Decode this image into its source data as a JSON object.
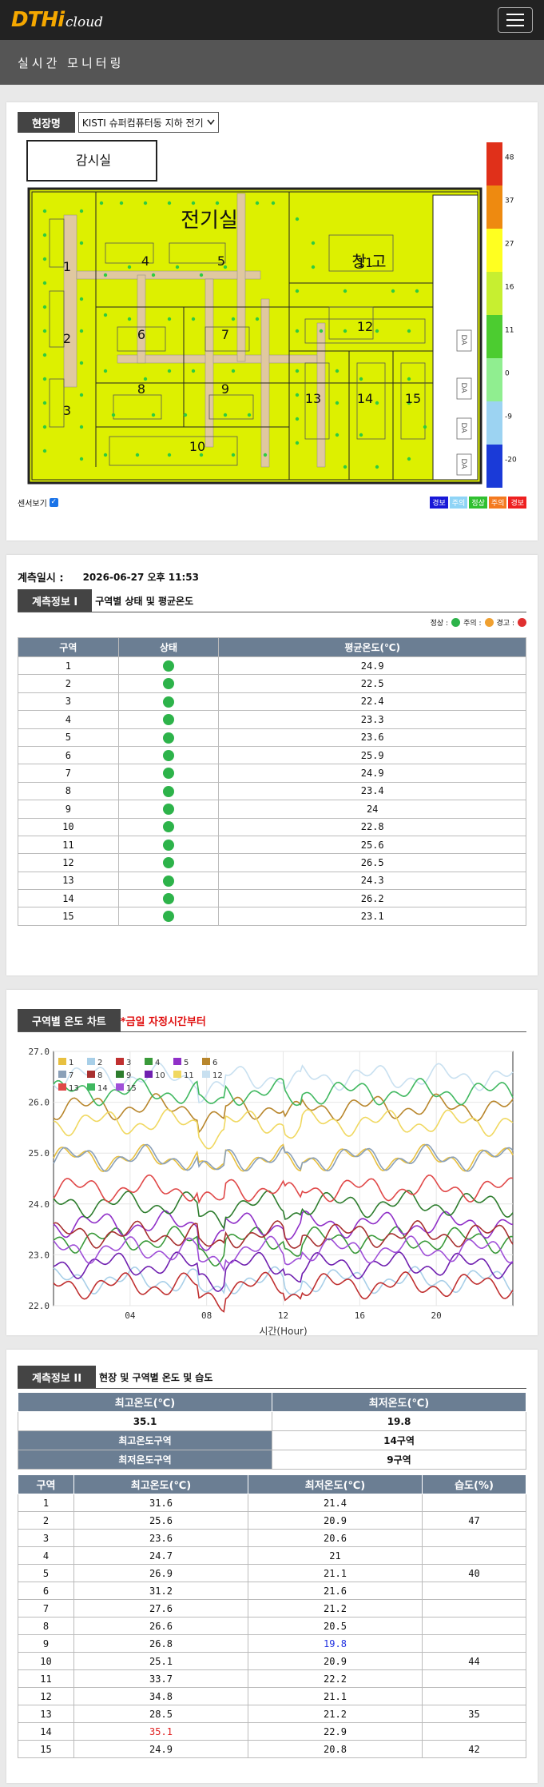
{
  "header": {
    "logo_main": "DTHi",
    "logo_sub": "cloud"
  },
  "subbar": {
    "title": "실시간 모니터링"
  },
  "site": {
    "label": "현장명",
    "selected": "KISTI 슈퍼컴퓨터동 지하 전기",
    "room_labels": {
      "control": "감시실",
      "electric": "전기실",
      "storage": "창 고"
    },
    "zones": [
      "1",
      "2",
      "3",
      "4",
      "5",
      "6",
      "7",
      "8",
      "9",
      "10",
      "11",
      "12",
      "13",
      "14",
      "15"
    ],
    "scale_labels": [
      "48",
      "37",
      "27",
      "16",
      "11",
      "0",
      "-9",
      "-20"
    ],
    "scale_colors": [
      "#e0301a",
      "#ee8a10",
      "#ffff20",
      "#c7ef30",
      "#4ccc30",
      "#90ee90",
      "#9cd3f2",
      "#1a3ad8"
    ],
    "sensor_label": "센서보기",
    "status_buttons": [
      {
        "label": "경보",
        "color": "#1818d8"
      },
      {
        "label": "주의",
        "color": "#8fd4f6"
      },
      {
        "label": "정상",
        "color": "#30c030"
      },
      {
        "label": "주의",
        "color": "#f47a20"
      },
      {
        "label": "경보",
        "color": "#ee2020"
      }
    ],
    "door_label": "DA"
  },
  "measure": {
    "time_label": "계측일시 :",
    "time_value": "2026-06-27 오후 11:53",
    "section_tag": "계측정보 I",
    "section_desc": "구역별 상태 및 평균온도",
    "legend": {
      "normal": "정상 :",
      "caution": "주의 :",
      "warning": "경고 :"
    },
    "headers": [
      "구역",
      "상태",
      "평균온도(℃)"
    ],
    "rows": [
      {
        "zone": "1",
        "avg": "24.9"
      },
      {
        "zone": "2",
        "avg": "22.5"
      },
      {
        "zone": "3",
        "avg": "22.4"
      },
      {
        "zone": "4",
        "avg": "23.3"
      },
      {
        "zone": "5",
        "avg": "23.6"
      },
      {
        "zone": "6",
        "avg": "25.9"
      },
      {
        "zone": "7",
        "avg": "24.9"
      },
      {
        "zone": "8",
        "avg": "23.4"
      },
      {
        "zone": "9",
        "avg": "24"
      },
      {
        "zone": "10",
        "avg": "22.8"
      },
      {
        "zone": "11",
        "avg": "25.6"
      },
      {
        "zone": "12",
        "avg": "26.5"
      },
      {
        "zone": "13",
        "avg": "24.3"
      },
      {
        "zone": "14",
        "avg": "26.2"
      },
      {
        "zone": "15",
        "avg": "23.1"
      }
    ]
  },
  "chart_section": {
    "tag": "구역별 온도 차트",
    "note": "*금일 자정시간부터"
  },
  "chart_data": {
    "type": "line",
    "xlabel": "시간(Hour)",
    "ylabel": "",
    "xlim": [
      0,
      24
    ],
    "ylim": [
      22.0,
      27.0
    ],
    "xticks": [
      "04",
      "08",
      "12",
      "16",
      "20"
    ],
    "yticks": [
      "27.0",
      "26.0",
      "25.0",
      "24.0",
      "23.0",
      "22.0"
    ],
    "grid": true,
    "legend_position": "top-left",
    "series": [
      {
        "name": "1",
        "color": "#e8c040",
        "base": 24.9
      },
      {
        "name": "2",
        "color": "#a8cfe8",
        "base": 22.5
      },
      {
        "name": "3",
        "color": "#c03030",
        "base": 22.4
      },
      {
        "name": "4",
        "color": "#3a9a3a",
        "base": 23.3
      },
      {
        "name": "5",
        "color": "#9030c8",
        "base": 23.6
      },
      {
        "name": "6",
        "color": "#b8862c",
        "base": 25.9
      },
      {
        "name": "7",
        "color": "#8aa0b8",
        "base": 24.9
      },
      {
        "name": "8",
        "color": "#a83030",
        "base": 23.4
      },
      {
        "name": "9",
        "color": "#2e7d2e",
        "base": 24.0
      },
      {
        "name": "10",
        "color": "#7020b0",
        "base": 22.8
      },
      {
        "name": "11",
        "color": "#f0d860",
        "base": 25.6
      },
      {
        "name": "12",
        "color": "#c8e0f0",
        "base": 26.5
      },
      {
        "name": "13",
        "color": "#e04848",
        "base": 24.3
      },
      {
        "name": "14",
        "color": "#40b860",
        "base": 26.2
      },
      {
        "name": "15",
        "color": "#a050d8",
        "base": 23.1
      }
    ]
  },
  "measure2": {
    "section_tag": "계측정보 II",
    "section_desc": "현장 및 구역별 온도 및 습도",
    "max_label": "최고온도(℃)",
    "min_label": "최저온도(℃)",
    "max_value": "35.1",
    "min_value": "19.8",
    "max_zone_label": "최고온도구역",
    "max_zone_value": "14구역",
    "min_zone_label": "최저온도구역",
    "min_zone_value": "9구역",
    "headers": [
      "구역",
      "최고온도(℃)",
      "최저온도(℃)",
      "습도(%)"
    ],
    "rows": [
      {
        "zone": "1",
        "max": "31.6",
        "min": "21.4",
        "hum": ""
      },
      {
        "zone": "2",
        "max": "25.6",
        "min": "20.9",
        "hum": "47"
      },
      {
        "zone": "3",
        "max": "23.6",
        "min": "20.6",
        "hum": ""
      },
      {
        "zone": "4",
        "max": "24.7",
        "min": "21",
        "hum": ""
      },
      {
        "zone": "5",
        "max": "26.9",
        "min": "21.1",
        "hum": "40"
      },
      {
        "zone": "6",
        "max": "31.2",
        "min": "21.6",
        "hum": ""
      },
      {
        "zone": "7",
        "max": "27.6",
        "min": "21.2",
        "hum": ""
      },
      {
        "zone": "8",
        "max": "26.6",
        "min": "20.5",
        "hum": ""
      },
      {
        "zone": "9",
        "max": "26.8",
        "min": "19.8",
        "hum": ""
      },
      {
        "zone": "10",
        "max": "25.1",
        "min": "20.9",
        "hum": "44"
      },
      {
        "zone": "11",
        "max": "33.7",
        "min": "22.2",
        "hum": ""
      },
      {
        "zone": "12",
        "max": "34.8",
        "min": "21.1",
        "hum": ""
      },
      {
        "zone": "13",
        "max": "28.5",
        "min": "21.2",
        "hum": "35"
      },
      {
        "zone": "14",
        "max": "35.1",
        "min": "22.9",
        "hum": ""
      },
      {
        "zone": "15",
        "max": "24.9",
        "min": "20.8",
        "hum": "42"
      }
    ]
  }
}
